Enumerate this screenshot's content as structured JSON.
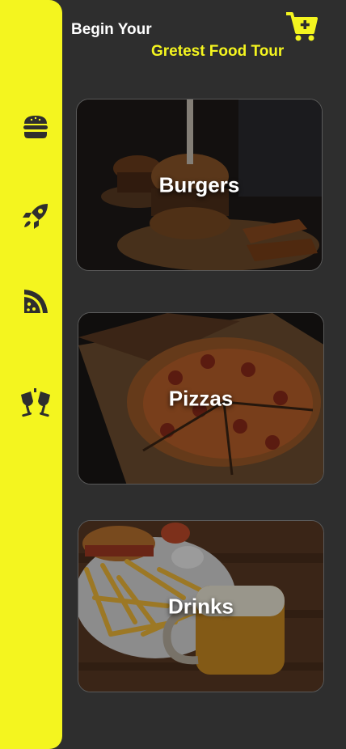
{
  "header": {
    "line1": "Begin Your",
    "line2": "Gretest Food Tour"
  },
  "sidebar": {
    "items": [
      {
        "icon": "burger-icon"
      },
      {
        "icon": "rocket-icon"
      },
      {
        "icon": "pizza-slice-icon"
      },
      {
        "icon": "glasses-cheers-icon"
      }
    ]
  },
  "cart": {
    "icon": "cart-plus-icon"
  },
  "cards": [
    {
      "title": "Burgers"
    },
    {
      "title": "Pizzas"
    },
    {
      "title": "Drinks"
    }
  ],
  "colors": {
    "background": "#2e2e2e",
    "accent": "#f4f51f",
    "icon": "#2e2e2e",
    "text": "#ffffff"
  }
}
